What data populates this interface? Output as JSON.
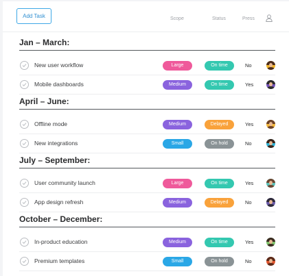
{
  "header": {
    "add_task_label": "Add Task",
    "columns": {
      "scope": "Scope",
      "status": "Status",
      "press": "Press"
    },
    "user_icon": "user-icon"
  },
  "colors": {
    "Large": "#ef5a9b",
    "Medium": "#8a63de",
    "Small": "#2aa7e6",
    "On time": "#34c8b0",
    "Delayed": "#f9a23b",
    "On hold": "#8a9396"
  },
  "sections": [
    {
      "title": "Jan – March:",
      "tasks": [
        {
          "name": "New user workflow",
          "scope": "Large",
          "status": "On time",
          "press": "No",
          "avatar_bg": "#f1b52a",
          "avatar_hair": "#4a2b1c"
        },
        {
          "name": "Mobile dashboards",
          "scope": "Medium",
          "status": "On time",
          "press": "Yes",
          "avatar_bg": "#7452b8",
          "avatar_hair": "#2b2b2b"
        }
      ]
    },
    {
      "title": "April – June:",
      "tasks": [
        {
          "name": "Offline mode",
          "scope": "Medium",
          "status": "Delayed",
          "press": "Yes",
          "avatar_bg": "#f2b63a",
          "avatar_hair": "#6b4127"
        },
        {
          "name": "New integrations",
          "scope": "Small",
          "status": "On hold",
          "press": "No",
          "avatar_bg": "#2fb3d6",
          "avatar_hair": "#3a2418"
        }
      ]
    },
    {
      "title": "July – September:",
      "tasks": [
        {
          "name": "User community launch",
          "scope": "Large",
          "status": "On time",
          "press": "Yes",
          "avatar_bg": "#5ac1b8",
          "avatar_hair": "#6a4630"
        },
        {
          "name": "App design refresh",
          "scope": "Medium",
          "status": "Delayed",
          "press": "No",
          "avatar_bg": "#6a5aa8",
          "avatar_hair": "#2d2a3a"
        }
      ]
    },
    {
      "title": "October – December:",
      "tasks": [
        {
          "name": "In-product education",
          "scope": "Medium",
          "status": "On time",
          "press": "Yes",
          "avatar_bg": "#7dc06a",
          "avatar_hair": "#3a2a20"
        },
        {
          "name": "Premium templates",
          "scope": "Small",
          "status": "On hold",
          "press": "No",
          "avatar_bg": "#e0562f",
          "avatar_hair": "#5a2a1a"
        }
      ]
    }
  ]
}
